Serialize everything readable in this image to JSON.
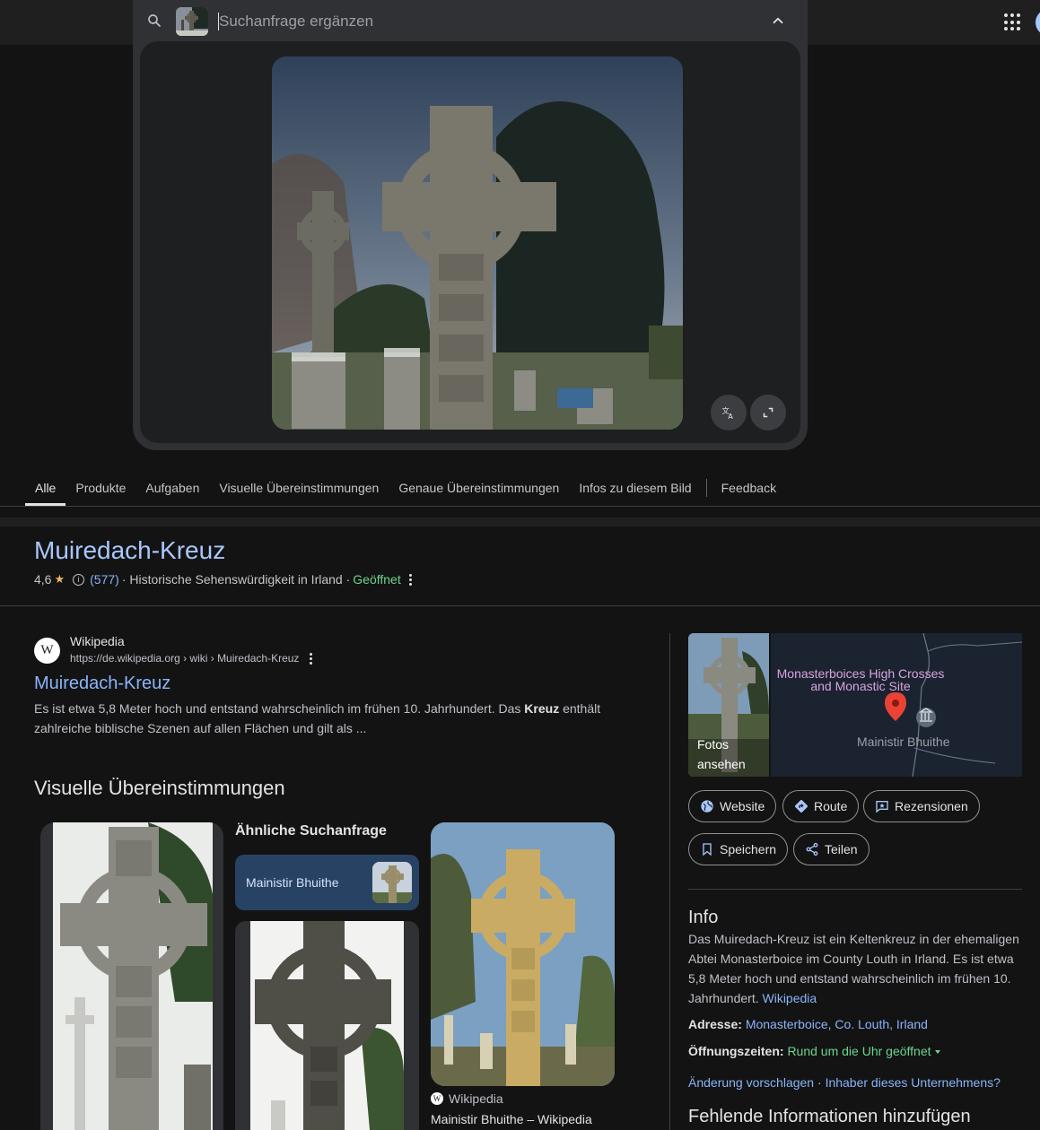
{
  "search": {
    "placeholder": "Suchanfrage ergänzen"
  },
  "tabs": [
    "Alle",
    "Produkte",
    "Aufgaben",
    "Visuelle Übereinstimmungen",
    "Genaue Übereinstimmungen",
    "Infos zu diesem Bild",
    "Feedback"
  ],
  "active_tab": "Alle",
  "knowledge": {
    "title": "Muiredach-Kreuz",
    "rating": "4,6",
    "review_count": "(577)",
    "category": "· Historische Sehenswürdigkeit in Irland ·",
    "status": "Geöffnet"
  },
  "wiki_result": {
    "logo": "W",
    "source": "Wikipedia",
    "url": "https://de.wikipedia.org › wiki › Muiredach-Kreuz",
    "title": "Muiredach-Kreuz",
    "snippet_before": "Es ist etwa 5,8 Meter hoch und entstand wahrscheinlich im frühen 10. Jahrhundert. Das ",
    "snippet_bold": "Kreuz",
    "snippet_after": " enthält zahlreiche biblische Szenen auf allen Flächen und gilt als ..."
  },
  "visual_matches": {
    "heading": "Visuelle Übereinstimmungen",
    "similar_label": "Ähnliche Suchanfrage",
    "chip_label": "Mainistir Bhuithe",
    "card3_source": "Wikipedia",
    "card3_title": "Mainistir Bhuithe – Wikipedia"
  },
  "side_panel": {
    "photos_label": "Fotos ansehen",
    "map_site_label": "Monasterboices High Crosses and Monastic Site",
    "map_town_label": "Mainistir Bhuithe",
    "actions": {
      "website": "Website",
      "route": "Route",
      "reviews": "Rezensionen",
      "save": "Speichern",
      "share": "Teilen"
    },
    "info_title": "Info",
    "info_text": "Das Muiredach-Kreuz ist ein Keltenkreuz in der ehemaligen Abtei Monasterboice im County Louth in Irland. Es ist etwa 5,8 Meter hoch und entstand wahrscheinlich im frühen 10. Jahrhundert.",
    "info_link": "Wikipedia",
    "address_label": "Adresse:",
    "address_value": "Monasterboice, Co. Louth, Irland",
    "hours_label": "Öffnungszeiten:",
    "hours_value": "Rund um die Uhr geöffnet",
    "suggest_edit": "Änderung vorschlagen",
    "separator": "·",
    "owner": "Inhaber dieses Unternehmens?",
    "missing_info": "Fehlende Informationen hinzufügen"
  },
  "colors": {
    "background": "#131314",
    "link": "#8ab4f8",
    "title_blue": "#a8c7fa",
    "open_green": "#6dd58c",
    "star": "#e9b65c",
    "chip_bg": "#284263"
  }
}
